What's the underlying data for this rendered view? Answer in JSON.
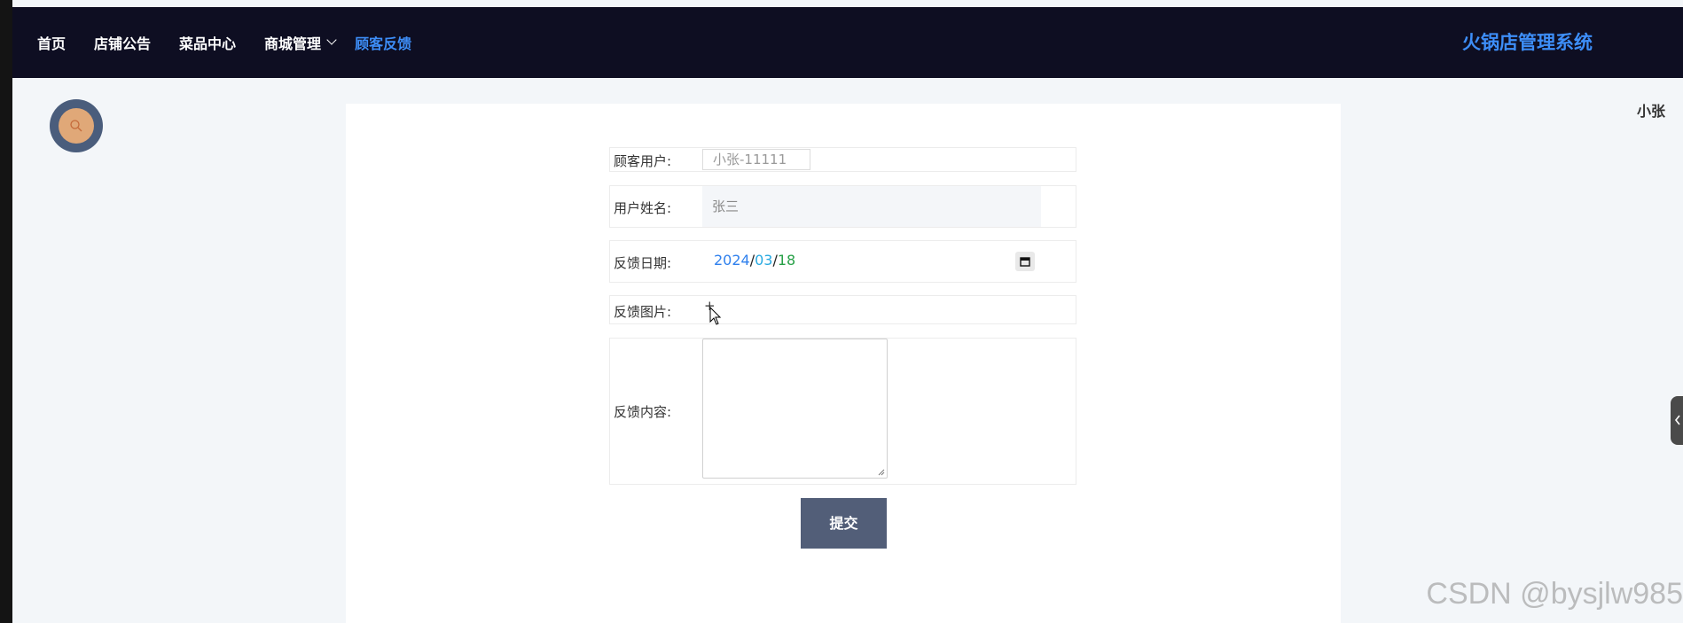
{
  "nav": {
    "items": [
      {
        "label": "首页"
      },
      {
        "label": "店铺公告"
      },
      {
        "label": "菜品中心"
      },
      {
        "label": "商城管理"
      },
      {
        "label": "顾客反馈"
      }
    ],
    "active_label": "顾客反馈",
    "brand": "火锅店管理系统"
  },
  "user": {
    "name": "小张",
    "avatar_icon": "search-icon"
  },
  "form": {
    "user_label": "顾客用户:",
    "user_value": "小张-11111",
    "name_label": "用户姓名:",
    "name_value": "张三",
    "date_label": "反馈日期:",
    "date": {
      "year": "2024",
      "month": "03",
      "day": "18",
      "sep": "/"
    },
    "image_label": "反馈图片:",
    "image_add": "+",
    "content_label": "反馈内容:",
    "content_value": "",
    "submit_label": "提交"
  },
  "watermark": "CSDN @bysjlw985",
  "colors": {
    "topbar": "#0e0e22",
    "accent": "#3d8ef8",
    "submit": "#525e78",
    "avatar_ring": "#4a5d7c",
    "avatar_fill": "#e0a878"
  }
}
